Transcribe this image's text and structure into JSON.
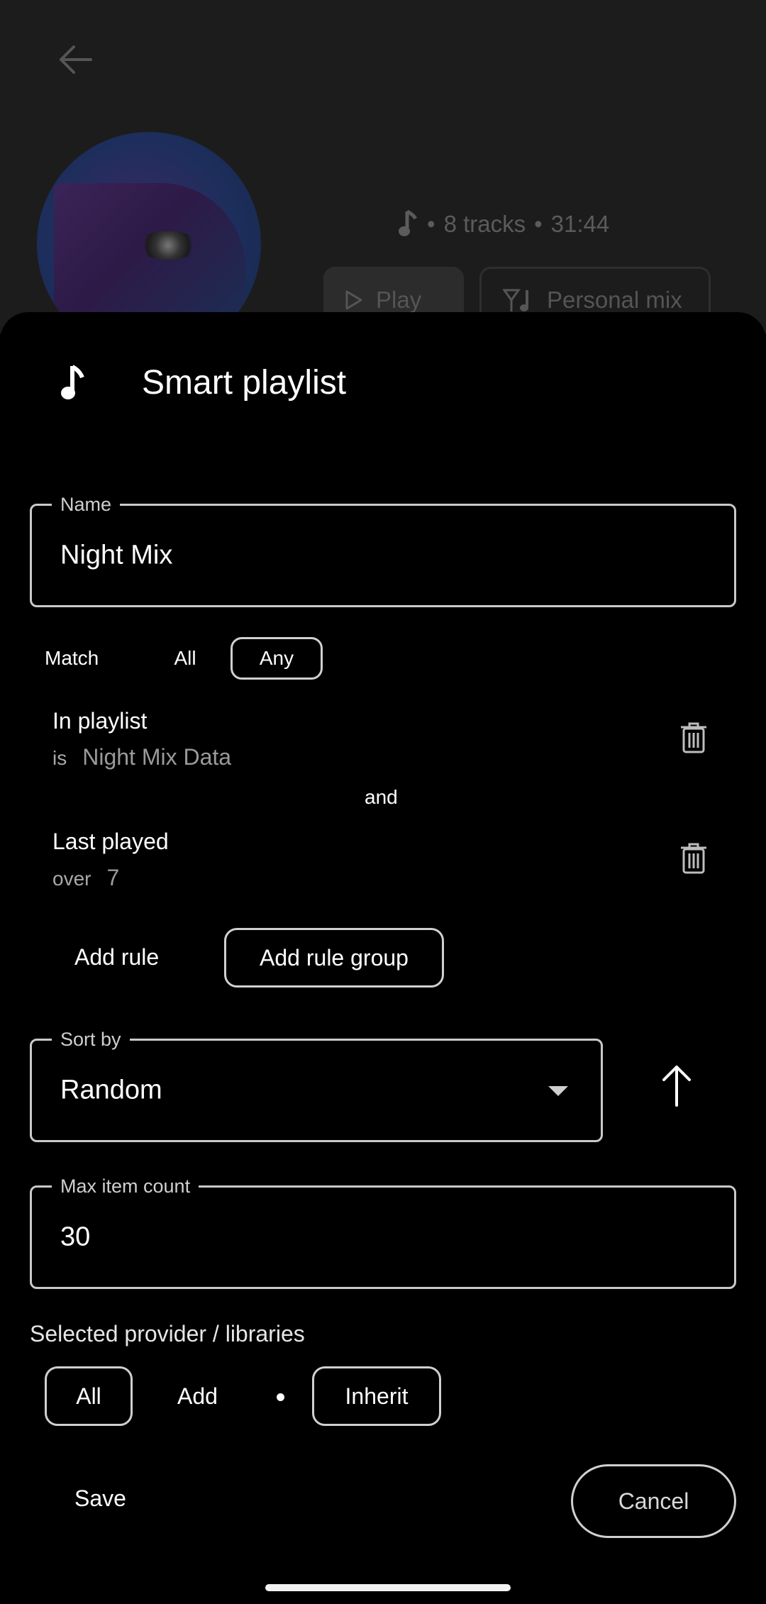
{
  "background": {
    "track_count": "8 tracks",
    "duration": "31:44",
    "separator": "•",
    "play_label": "Play",
    "mix_label": "Personal mix"
  },
  "sheet": {
    "title": "Smart playlist",
    "name_field": {
      "label": "Name",
      "value": "Night Mix"
    },
    "match": {
      "label": "Match",
      "options": [
        "All",
        "Any"
      ],
      "selected": "Any"
    },
    "rules": [
      {
        "title": "In playlist",
        "operator": "is",
        "value": "Night Mix Data"
      },
      {
        "title": "Last played",
        "operator": "over",
        "value": "7"
      }
    ],
    "conjunction": "and",
    "add_rule_label": "Add rule",
    "add_rule_group_label": "Add rule group",
    "sort": {
      "label": "Sort by",
      "value": "Random",
      "direction": "ascending"
    },
    "max_count": {
      "label": "Max item count",
      "value": "30"
    },
    "providers": {
      "label": "Selected provider / libraries",
      "all_label": "All",
      "add_label": "Add",
      "separator": "•",
      "inherit_label": "Inherit"
    },
    "save_label": "Save",
    "cancel_label": "Cancel"
  },
  "colors": {
    "background": "#000000",
    "outline": "#c9c9c9",
    "muted_text": "#9a9a9a",
    "dim_overlay": "#1c1c1c"
  }
}
